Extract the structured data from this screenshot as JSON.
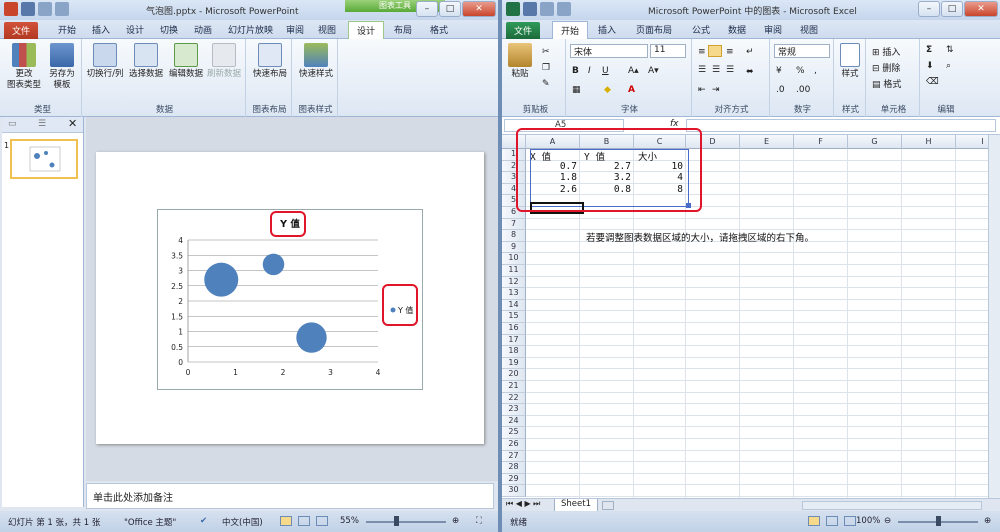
{
  "ppt": {
    "title": "气泡图.pptx - Microsoft PowerPoint",
    "context_tab_group": "图表工具",
    "file_tab": "文件",
    "tabs": [
      "开始",
      "插入",
      "设计",
      "切换",
      "动画",
      "幻灯片放映",
      "审阅",
      "视图",
      "设计",
      "布局",
      "格式"
    ],
    "ribbon_groups": [
      {
        "label": "类型",
        "buttons": [
          "更改\n图表类型",
          "另存为\n模板"
        ]
      },
      {
        "label": "数据",
        "buttons": [
          "切换行/列",
          "选择数据",
          "编辑数据",
          "刷新数据"
        ]
      },
      {
        "label": "图表布局",
        "buttons": [
          "快速布局"
        ]
      },
      {
        "label": "图表样式",
        "buttons": [
          "快速样式"
        ]
      }
    ],
    "slide_number": "1",
    "notes_placeholder": "单击此处添加备注",
    "status": {
      "slide_info": "幻灯片 第 1 张，共 1 张",
      "theme": "\"Office 主题\"",
      "language": "中文(中国)",
      "zoom": "55%"
    },
    "chart": {
      "title": "Y 值",
      "legend": "Y 值",
      "y_ticks": [
        "4",
        "3.5",
        "3",
        "2.5",
        "2",
        "1.5",
        "1",
        "0.5",
        "0"
      ],
      "x_ticks": [
        "0",
        "1",
        "2",
        "3",
        "4"
      ]
    }
  },
  "excel": {
    "title": "Microsoft PowerPoint 中的图表 - Microsoft Excel",
    "file_tab": "文件",
    "tabs": [
      "开始",
      "插入",
      "页面布局",
      "公式",
      "数据",
      "审阅",
      "视图"
    ],
    "font_name": "宋体",
    "font_size": "11",
    "number_format": "常规",
    "ribbon_groups": [
      "剪贴板",
      "字体",
      "对齐方式",
      "数字",
      "样式",
      "单元格",
      "编辑"
    ],
    "ribbon_labels": {
      "paste": "粘贴",
      "styles": "样式",
      "insert": "插入",
      "delete": "删除",
      "format": "格式"
    },
    "name_box": "A5",
    "columns": [
      "A",
      "B",
      "C",
      "D",
      "E",
      "F",
      "G",
      "H",
      "I"
    ],
    "rows": [
      "1",
      "2",
      "3",
      "4",
      "5",
      "6",
      "7",
      "8",
      "9",
      "10",
      "11",
      "12",
      "13",
      "14",
      "15",
      "16",
      "17",
      "18",
      "19",
      "20",
      "21",
      "22",
      "23",
      "24",
      "25",
      "26",
      "27",
      "28",
      "29",
      "30"
    ],
    "headers": [
      "X 值",
      "Y 值",
      "大小"
    ],
    "data": [
      [
        "0.7",
        "2.7",
        "10"
      ],
      [
        "1.8",
        "3.2",
        "4"
      ],
      [
        "2.6",
        "0.8",
        "8"
      ]
    ],
    "hint": "若要调整图表数据区域的大小，请拖拽区域的右下角。",
    "sheet_tab": "Sheet1",
    "status_left": "就绪",
    "zoom": "100%"
  },
  "chart_data": {
    "type": "scatter",
    "subtype": "bubble",
    "title": "Y 值",
    "series": [
      {
        "name": "Y 值",
        "x": [
          0.7,
          1.8,
          2.6
        ],
        "y": [
          2.7,
          3.2,
          0.8
        ],
        "size": [
          10,
          4,
          8
        ],
        "color": "#4f81bd"
      }
    ],
    "xlim": [
      0,
      4
    ],
    "ylim": [
      0,
      4
    ],
    "grid": true,
    "legend": "right"
  },
  "colors": {
    "accent": "#4f81bd",
    "highlight": "#e0152a",
    "file_tab": "#2a6cc4",
    "excel_file_tab": "#217346"
  }
}
